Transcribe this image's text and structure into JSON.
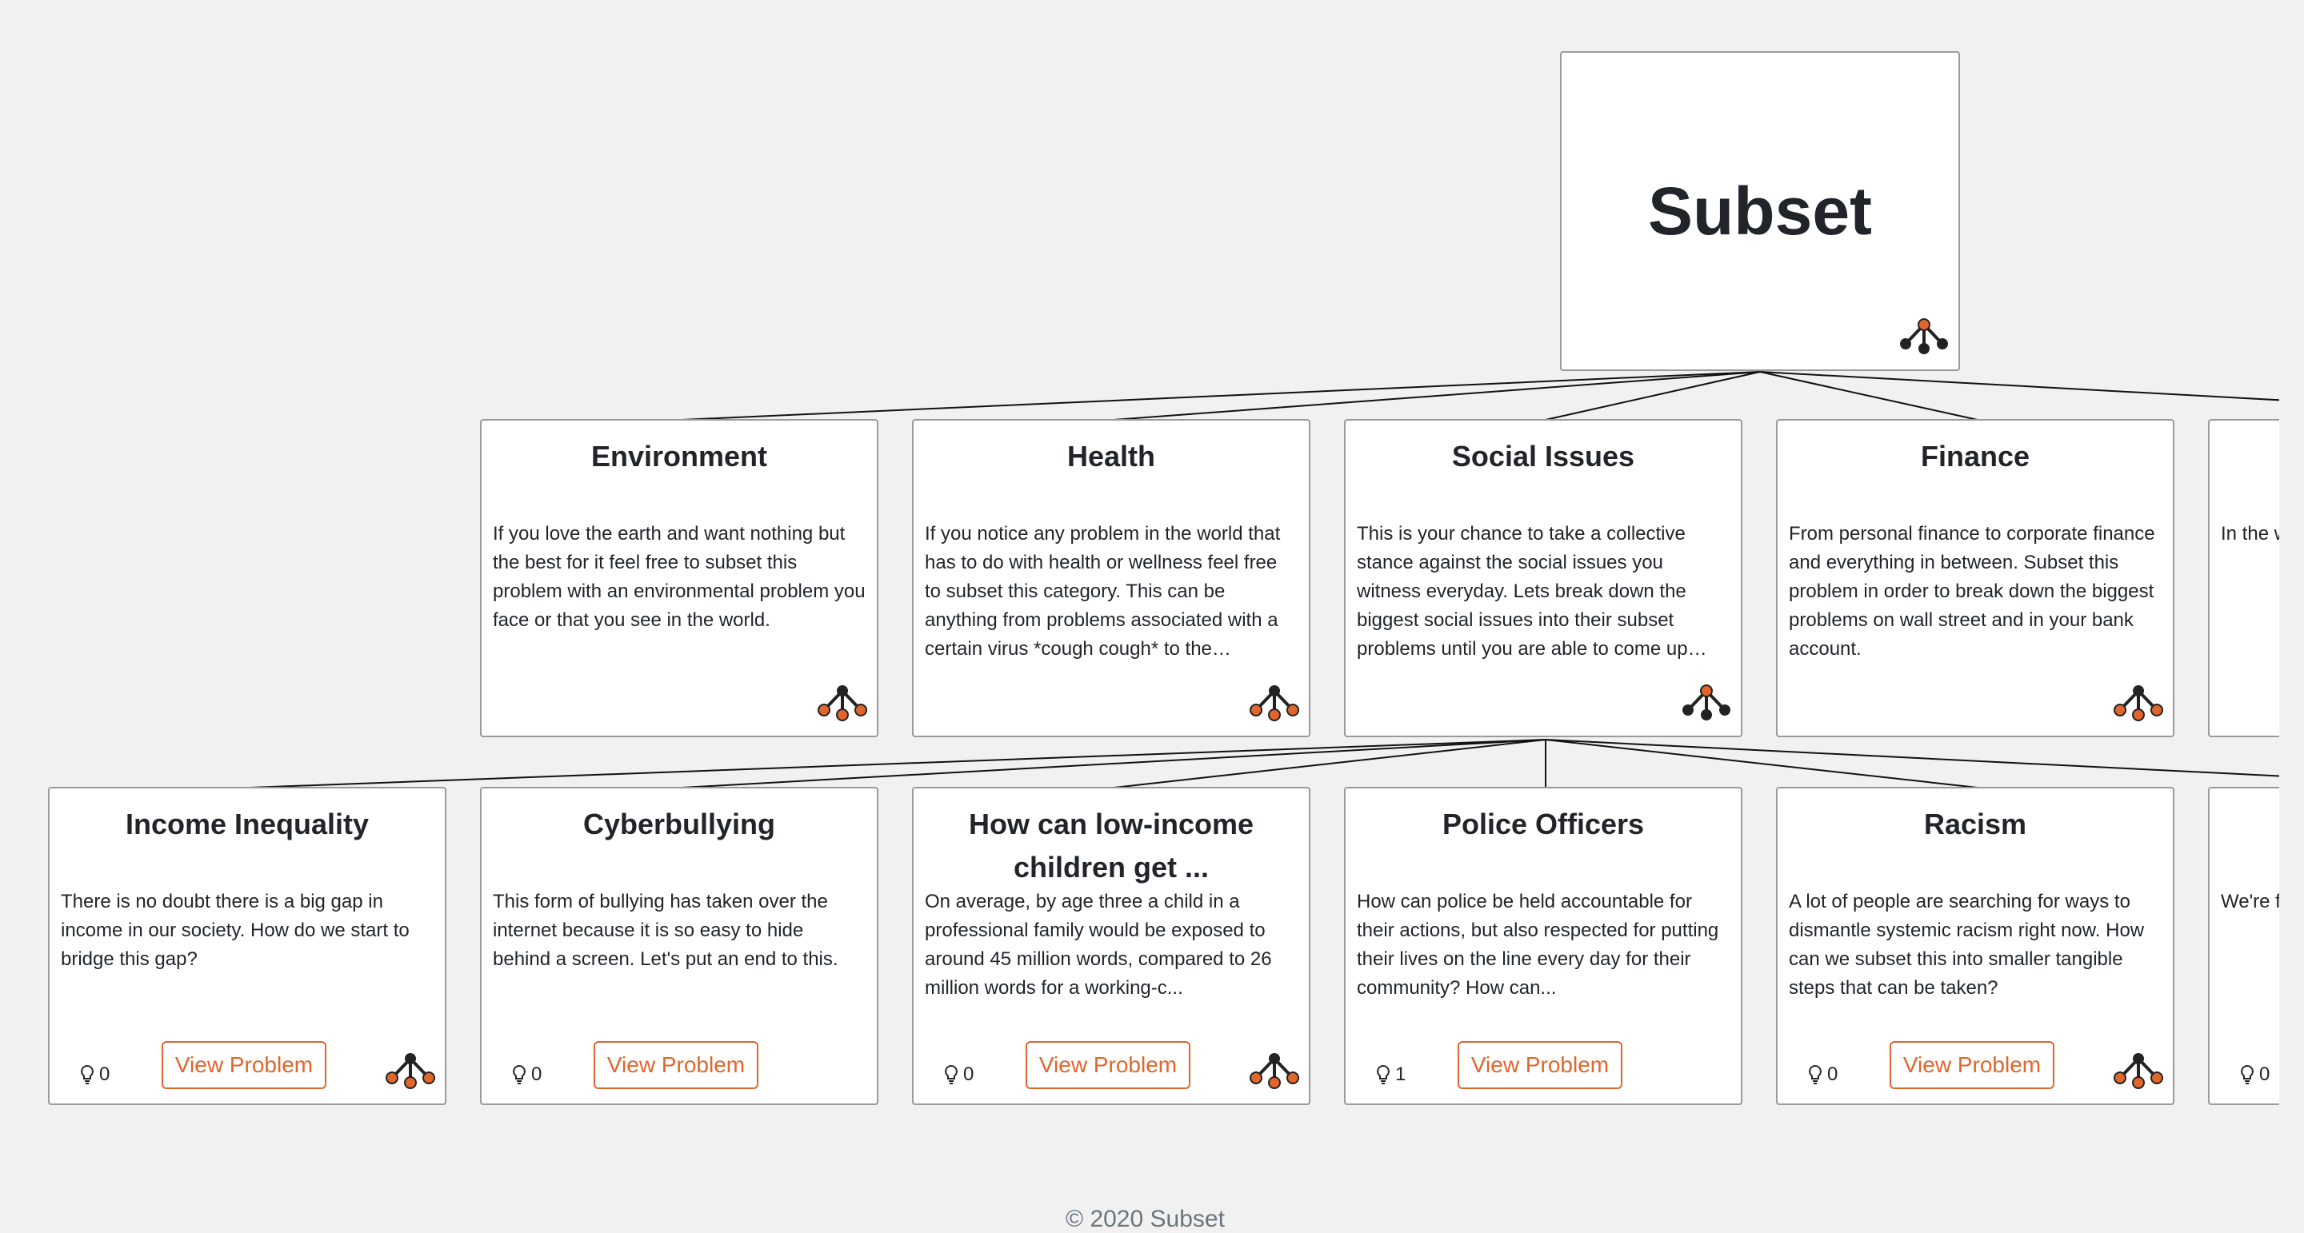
{
  "root": {
    "title": "Subset"
  },
  "categories": [
    {
      "title": "Environment",
      "description": "If you love the earth and want nothing but the best for it feel free to subset this problem with an environmental problem you face or that you see in the world."
    },
    {
      "title": "Health",
      "description": "If you notice any problem in the world that has to do with health or wellness feel free to subset this category. This can be anything from problems associated with a certain virus *cough cough* to the obstacles of a…"
    },
    {
      "title": "Social Issues",
      "description": "This is your chance to take a collective stance against the social issues you witness everyday. Lets break down the biggest social issues into their subset problems until you are able to come up wi…"
    },
    {
      "title": "Finance",
      "description": "From personal finance to corporate finance and everything in between. Subset this problem in order to break down the biggest problems on wall street and in your bank account."
    },
    {
      "title": "",
      "description": "In the w chance big pro pieces."
    }
  ],
  "problems": [
    {
      "title": "Income Inequality",
      "description": "There is no doubt there is a big gap in income in our society. How do we start to bridge this gap?",
      "ideas": "0",
      "button": "View Problem"
    },
    {
      "title": "Cyberbullying",
      "description": "This form of bullying has taken over the internet because it is so easy to hide behind a screen. Let's put an end to this.",
      "ideas": "0",
      "button": "View Problem"
    },
    {
      "title": "How can low-income children get ...",
      "description": "On average, by age three a child in a professional family would be exposed to around 45 million words, compared to 26 million words for a working-c...",
      "ideas": "0",
      "button": "View Problem"
    },
    {
      "title": "Police Officers",
      "description": "How can police be held accountable for their actions, but also respected for putting their lives on the line every day for their community? How can...",
      "ideas": "1",
      "button": "View Problem"
    },
    {
      "title": "Racism",
      "description": "A lot of people are searching for ways to dismantle systemic racism right now. How can we subset this into smaller tangible steps that can be taken?",
      "ideas": "0",
      "button": "View Problem"
    },
    {
      "title": "",
      "description": "We're f make a https://",
      "ideas": "0",
      "button": ""
    }
  ],
  "footer": {
    "text": "© 2020 Subset"
  },
  "colors": {
    "accent": "#e0662b",
    "dark": "#222222",
    "border": "#9a9a9a",
    "background": "#f1f1f1"
  },
  "icons": {
    "tree": "subset-tree-icon",
    "idea": "lightbulb-icon"
  }
}
